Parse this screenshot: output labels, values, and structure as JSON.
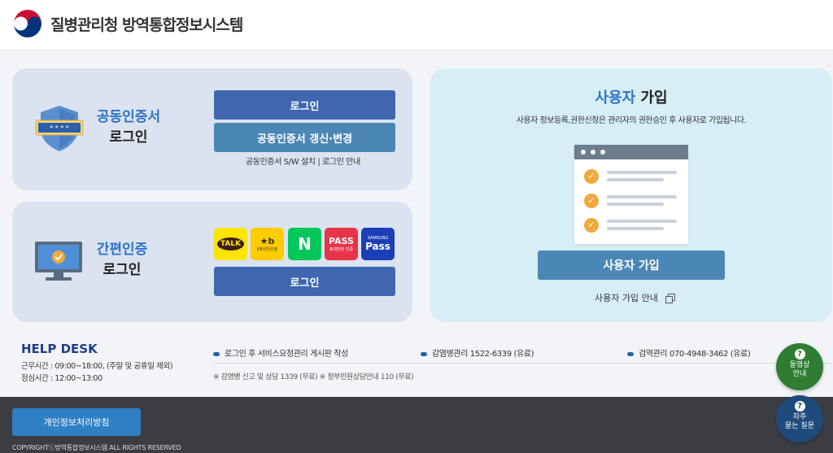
{
  "header": {
    "title": "질병관리청 방역통합정보시스템",
    "logo_icon": "korea-taegeuk-logo"
  },
  "cert_login": {
    "title_line1": "공동인증서",
    "title_line2": "로그인",
    "icon": "shield-password-icon",
    "login_button": "로그인",
    "renew_button": "공동인증서 갱신·변경",
    "sw_install_link": "공동인증서 S/W 설치",
    "separator": " | ",
    "login_guide_link": "로그인 안내"
  },
  "simple_login": {
    "title_line1": "간편인증",
    "title_line2": "로그인",
    "icon": "monitor-check-icon",
    "apps": [
      {
        "name": "kakao",
        "label": "TALK",
        "sub": "",
        "bg": "#fee500",
        "fg": "#3c1e1e"
      },
      {
        "name": "kb",
        "label": "★b",
        "sub": "KB국민은행",
        "bg": "#ffcc00",
        "fg": "#333333"
      },
      {
        "name": "naver",
        "label": "N",
        "sub": "",
        "bg": "#03c75a",
        "fg": "#ffffff"
      },
      {
        "name": "pass",
        "label": "PASS",
        "sub": "휴대전화 인증",
        "bg": "#e8344a",
        "fg": "#ffffff"
      },
      {
        "name": "samsung-pass",
        "label": "Pass",
        "sub": "SAMSUNG",
        "bg": "#1c3fb8",
        "fg": "#ffffff"
      }
    ],
    "login_button": "로그인"
  },
  "signup": {
    "title_prefix": "사용자",
    "title_suffix": " 가입",
    "description": "사용자 정보등록,권한신청은 관리자의 권한승인 후 사용자로 가입됩니다.",
    "button": "사용자 가입",
    "guide_link": "사용자 가입 안내",
    "colors": {
      "accent": "#2d73c8",
      "check": "#f0a93d"
    }
  },
  "help_desk": {
    "title": "HELP DESK",
    "hours": "근무시간 : 09:00~18:00, (주말 및 공휴일 제외)",
    "lunch": "점심시간 : 12:00~13:00",
    "item1": "로그인 후 서비스요청관리 게시판 작성",
    "item2": "감염병관리 1522-6339 (유료)",
    "item3": "검역관리 070-4948-3462 (유료)",
    "notes": "※ 감염병 신고 및 상담 1339 (무료)   ※ 정부민원상담안내 110 (무료)"
  },
  "footer": {
    "privacy_button": "개인정보처리방침",
    "copyright": "COPYRIGHTⓒ방역통합정보시스템 ALL RIGHTS RESERVED"
  },
  "floating": {
    "video_line1": "동영상",
    "video_line2": "안내",
    "faq_line1": "자주",
    "faq_line2": "묻는 질문",
    "q_mark": "?"
  }
}
